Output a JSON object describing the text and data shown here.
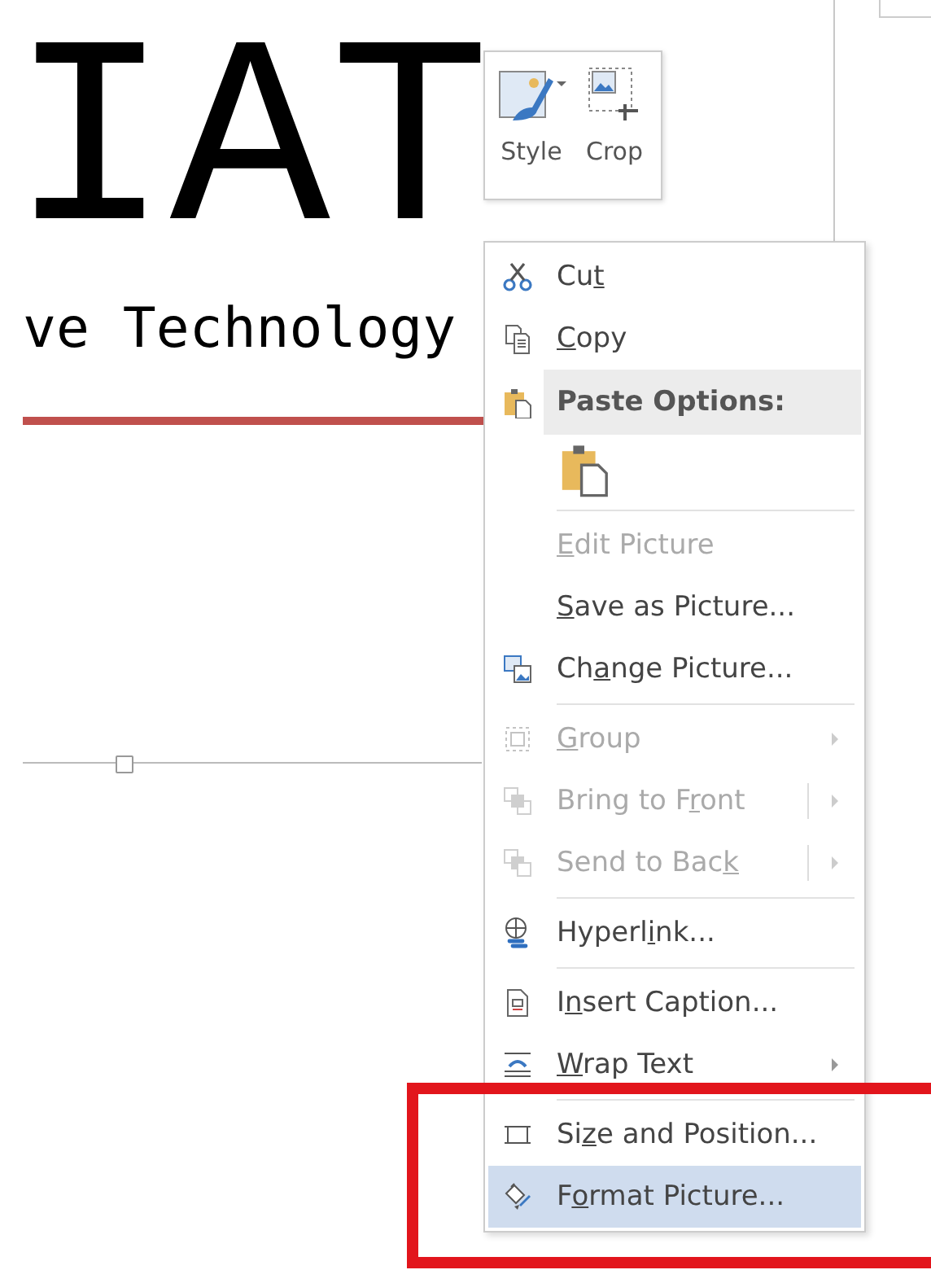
{
  "document": {
    "logo": "IAT",
    "tagline": "ve Technology"
  },
  "mini_toolbar": [
    {
      "label": "Style",
      "kind": "style"
    },
    {
      "label": "Crop",
      "kind": "crop"
    }
  ],
  "context_menu": [
    {
      "kind": "command",
      "label": {
        "pre": "Cu",
        "key": "t"
      },
      "disabled": false,
      "selected": false,
      "submenu": false,
      "split": false
    },
    {
      "kind": "command",
      "label": {
        "key": "C",
        "post": "opy"
      },
      "disabled": false,
      "selected": false,
      "submenu": false,
      "split": false
    },
    {
      "kind": "header",
      "label": {
        "post": "Paste Options:"
      }
    },
    {
      "kind": "paste"
    },
    {
      "kind": "separator"
    },
    {
      "kind": "command",
      "label": {
        "key": "E",
        "post": "dit Picture"
      },
      "disabled": true,
      "selected": false,
      "submenu": false,
      "split": false
    },
    {
      "kind": "command",
      "label": {
        "key": "S",
        "post": "ave as Picture..."
      },
      "disabled": false,
      "selected": false,
      "submenu": false,
      "split": false
    },
    {
      "kind": "command",
      "label": {
        "pre": "Ch",
        "key": "a",
        "post": "nge Picture..."
      },
      "disabled": false,
      "selected": false,
      "submenu": false,
      "split": false
    },
    {
      "kind": "separator"
    },
    {
      "kind": "command",
      "label": {
        "key": "G",
        "post": "roup"
      },
      "disabled": true,
      "selected": false,
      "submenu": true,
      "split": false
    },
    {
      "kind": "command",
      "label": {
        "pre": "Bring to F",
        "key": "r",
        "post": "ont"
      },
      "disabled": true,
      "selected": false,
      "submenu": true,
      "split": true
    },
    {
      "kind": "command",
      "label": {
        "pre": "Send to Bac",
        "key": "k"
      },
      "disabled": true,
      "selected": false,
      "submenu": true,
      "split": true
    },
    {
      "kind": "separator"
    },
    {
      "kind": "command",
      "label": {
        "pre": "Hyperl",
        "key": "i",
        "post": "nk..."
      },
      "disabled": false,
      "selected": false,
      "submenu": false,
      "split": false
    },
    {
      "kind": "separator"
    },
    {
      "kind": "command",
      "label": {
        "pre": "I",
        "key": "n",
        "post": "sert Caption..."
      },
      "disabled": false,
      "selected": false,
      "submenu": false,
      "split": false
    },
    {
      "kind": "command",
      "label": {
        "key": "W",
        "post": "rap Text"
      },
      "disabled": false,
      "selected": false,
      "submenu": true,
      "split": false
    },
    {
      "kind": "separator"
    },
    {
      "kind": "command",
      "label": {
        "pre": "Si",
        "key": "z",
        "post": "e and Position..."
      },
      "disabled": false,
      "selected": false,
      "submenu": false,
      "split": false
    },
    {
      "kind": "command",
      "label": {
        "pre": "F",
        "key": "o",
        "post": "rmat Picture..."
      },
      "disabled": false,
      "selected": true,
      "submenu": false,
      "split": false
    }
  ]
}
